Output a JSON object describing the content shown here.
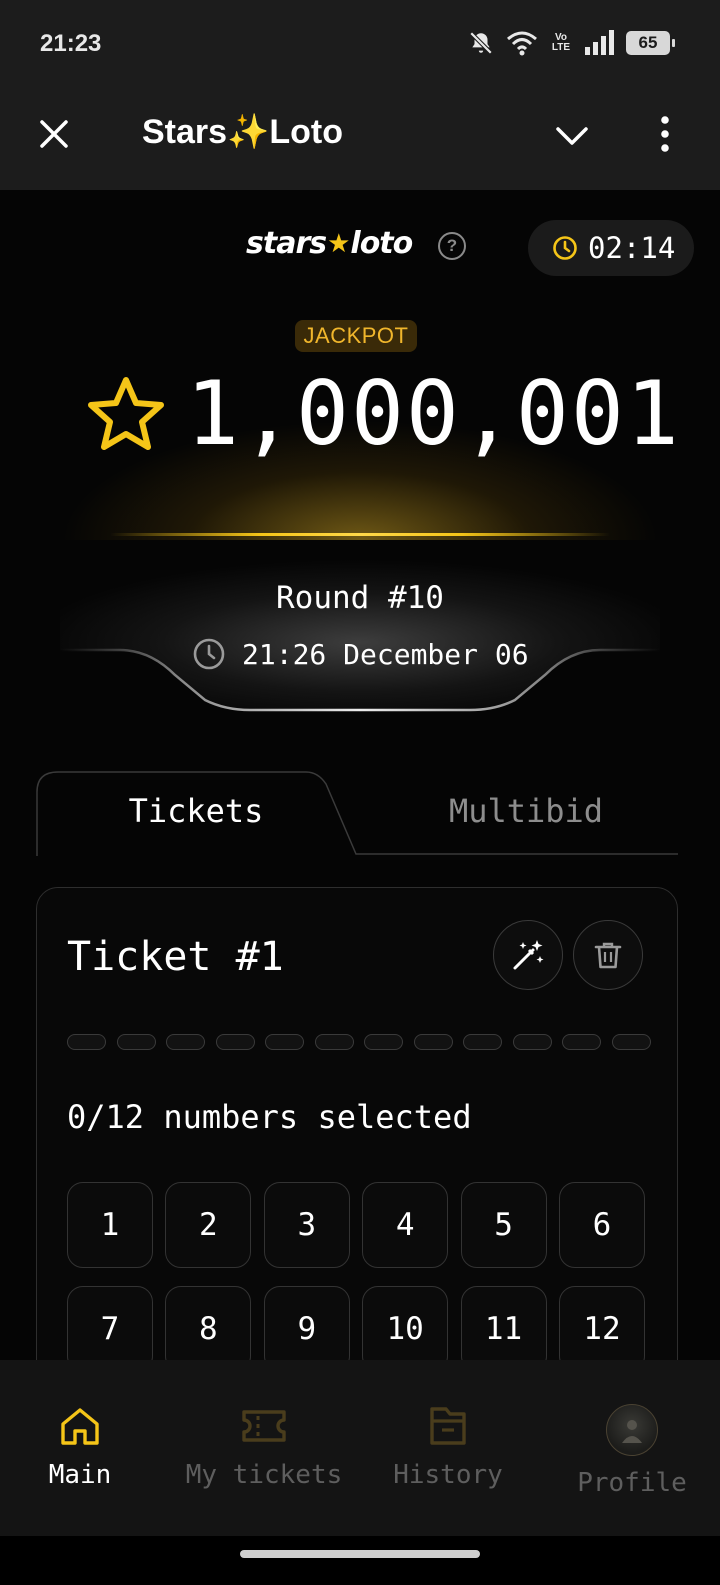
{
  "status_bar": {
    "time": "21:23",
    "network_label": "Vo LTE",
    "battery": "65"
  },
  "header": {
    "title": "Stars✨Loto",
    "icons": [
      "close-icon",
      "chevron-down-icon",
      "more-vertical-icon"
    ]
  },
  "brand": {
    "logo_left": "stars",
    "logo_star": "★",
    "logo_right": "loto",
    "help": "?",
    "accent_color": "#f5c518"
  },
  "timer": {
    "value": "02:14"
  },
  "jackpot": {
    "badge": "JACKPOT",
    "amount": "1,000,001"
  },
  "round": {
    "title": "Round #10",
    "datetime": "21:26 December 06"
  },
  "tabs": [
    {
      "label": "Tickets",
      "active": true
    },
    {
      "label": "Multibid",
      "active": false
    }
  ],
  "ticket": {
    "title": "Ticket #1",
    "selected_text": "0/12 numbers selected",
    "slots_total": 12,
    "slots_filled": 0,
    "numbers": [
      "1",
      "2",
      "3",
      "4",
      "5",
      "6",
      "7",
      "8",
      "9",
      "10",
      "11",
      "12"
    ]
  },
  "bottom_nav": [
    {
      "label": "Main",
      "icon": "home-icon",
      "active": true
    },
    {
      "label": "My tickets",
      "icon": "ticket-icon",
      "active": false
    },
    {
      "label": "History",
      "icon": "archive-icon",
      "active": false
    },
    {
      "label": "Profile",
      "icon": "avatar",
      "active": false
    }
  ]
}
